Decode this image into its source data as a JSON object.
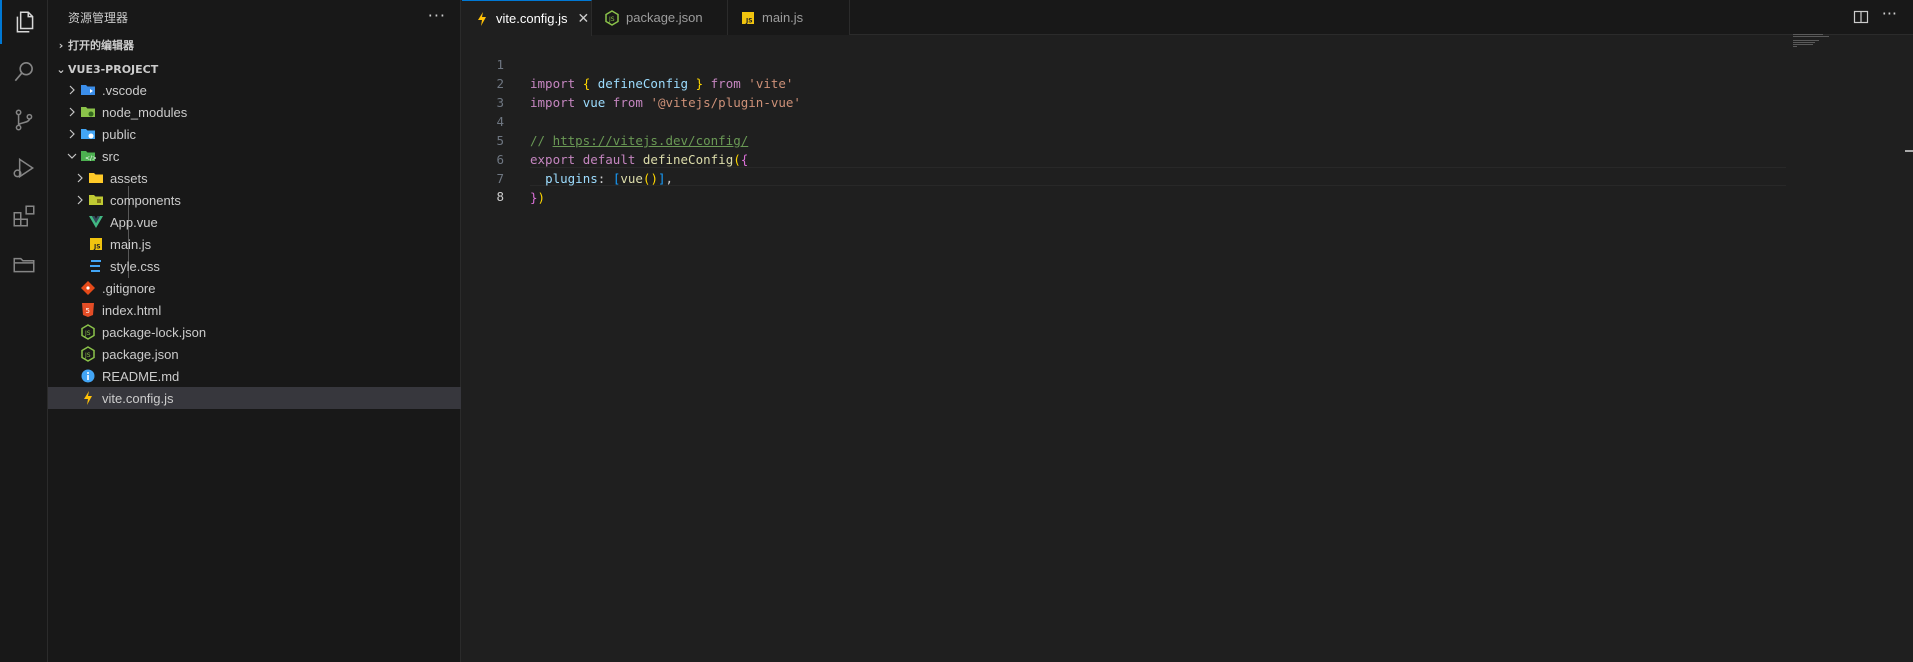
{
  "explorer": {
    "title": "资源管理器",
    "more": "···",
    "open_editors": "打开的编辑器",
    "project": "VUE3-PROJECT",
    "tree": [
      {
        "label": ".vscode",
        "type": "folder",
        "icon": "vscode-folder-icon",
        "color": "#3b8eea"
      },
      {
        "label": "node_modules",
        "type": "folder",
        "icon": "node-folder-icon",
        "color": "#8bc34a"
      },
      {
        "label": "public",
        "type": "folder",
        "icon": "public-folder-icon",
        "color": "#42a5f5"
      },
      {
        "label": "src",
        "type": "folder-open",
        "icon": "src-folder-icon",
        "color": "#4caf50"
      },
      {
        "label": "assets",
        "type": "folder",
        "icon": "assets-folder-icon",
        "color": "#ffca28"
      },
      {
        "label": "components",
        "type": "folder",
        "icon": "components-folder-icon",
        "color": "#c0ca33"
      },
      {
        "label": "App.vue",
        "type": "file",
        "icon": "vue-icon",
        "color": "#41b883"
      },
      {
        "label": "main.js",
        "type": "file",
        "icon": "js-icon",
        "color": "#f1c40f"
      },
      {
        "label": "style.css",
        "type": "file",
        "icon": "css-icon",
        "color": "#42a5f5"
      },
      {
        "label": ".gitignore",
        "type": "file",
        "icon": "git-icon",
        "color": "#e64a19"
      },
      {
        "label": "index.html",
        "type": "file",
        "icon": "html-icon",
        "color": "#e44d26"
      },
      {
        "label": "package-lock.json",
        "type": "file",
        "icon": "nodejs-icon",
        "color": "#8bc34a"
      },
      {
        "label": "package.json",
        "type": "file",
        "icon": "nodejs-icon",
        "color": "#8bc34a"
      },
      {
        "label": "README.md",
        "type": "file",
        "icon": "info-icon",
        "color": "#42a5f5"
      },
      {
        "label": "vite.config.js",
        "type": "file",
        "icon": "vite-icon",
        "color": "#ffc107",
        "selected": true
      }
    ]
  },
  "tabs": [
    {
      "label": "vite.config.js",
      "icon": "vite-icon",
      "active": true,
      "close": "✕"
    },
    {
      "label": "package.json",
      "icon": "nodejs-icon",
      "active": false
    },
    {
      "label": "main.js",
      "icon": "js-icon",
      "active": false
    }
  ],
  "editor": {
    "line_numbers": [
      "1",
      "2",
      "3",
      "4",
      "5",
      "6",
      "7",
      "8"
    ],
    "current_line": "8",
    "code": {
      "l1": {
        "kw": "import",
        "b_open": "{",
        "name": "defineConfig",
        "b_close": "}",
        "from": "from",
        "str": "'vite'"
      },
      "l2": {
        "kw": "import",
        "name": "vue",
        "from": "from",
        "str": "'@vitejs/plugin-vue'"
      },
      "l4": {
        "comment": "// ",
        "url": "https://vitejs.dev/config/"
      },
      "l5": {
        "kw": "export",
        "kw2": "default",
        "fn": "defineConfig",
        "p_open": "(",
        "b_open": "{"
      },
      "l6": {
        "prop": "plugins",
        "colon": ": ",
        "br_open": "[",
        "fn": "vue",
        "paren": "()",
        "br_close": "]",
        "comma": ","
      },
      "l7": {
        "b_close": "}",
        "p_close": ")"
      }
    }
  }
}
